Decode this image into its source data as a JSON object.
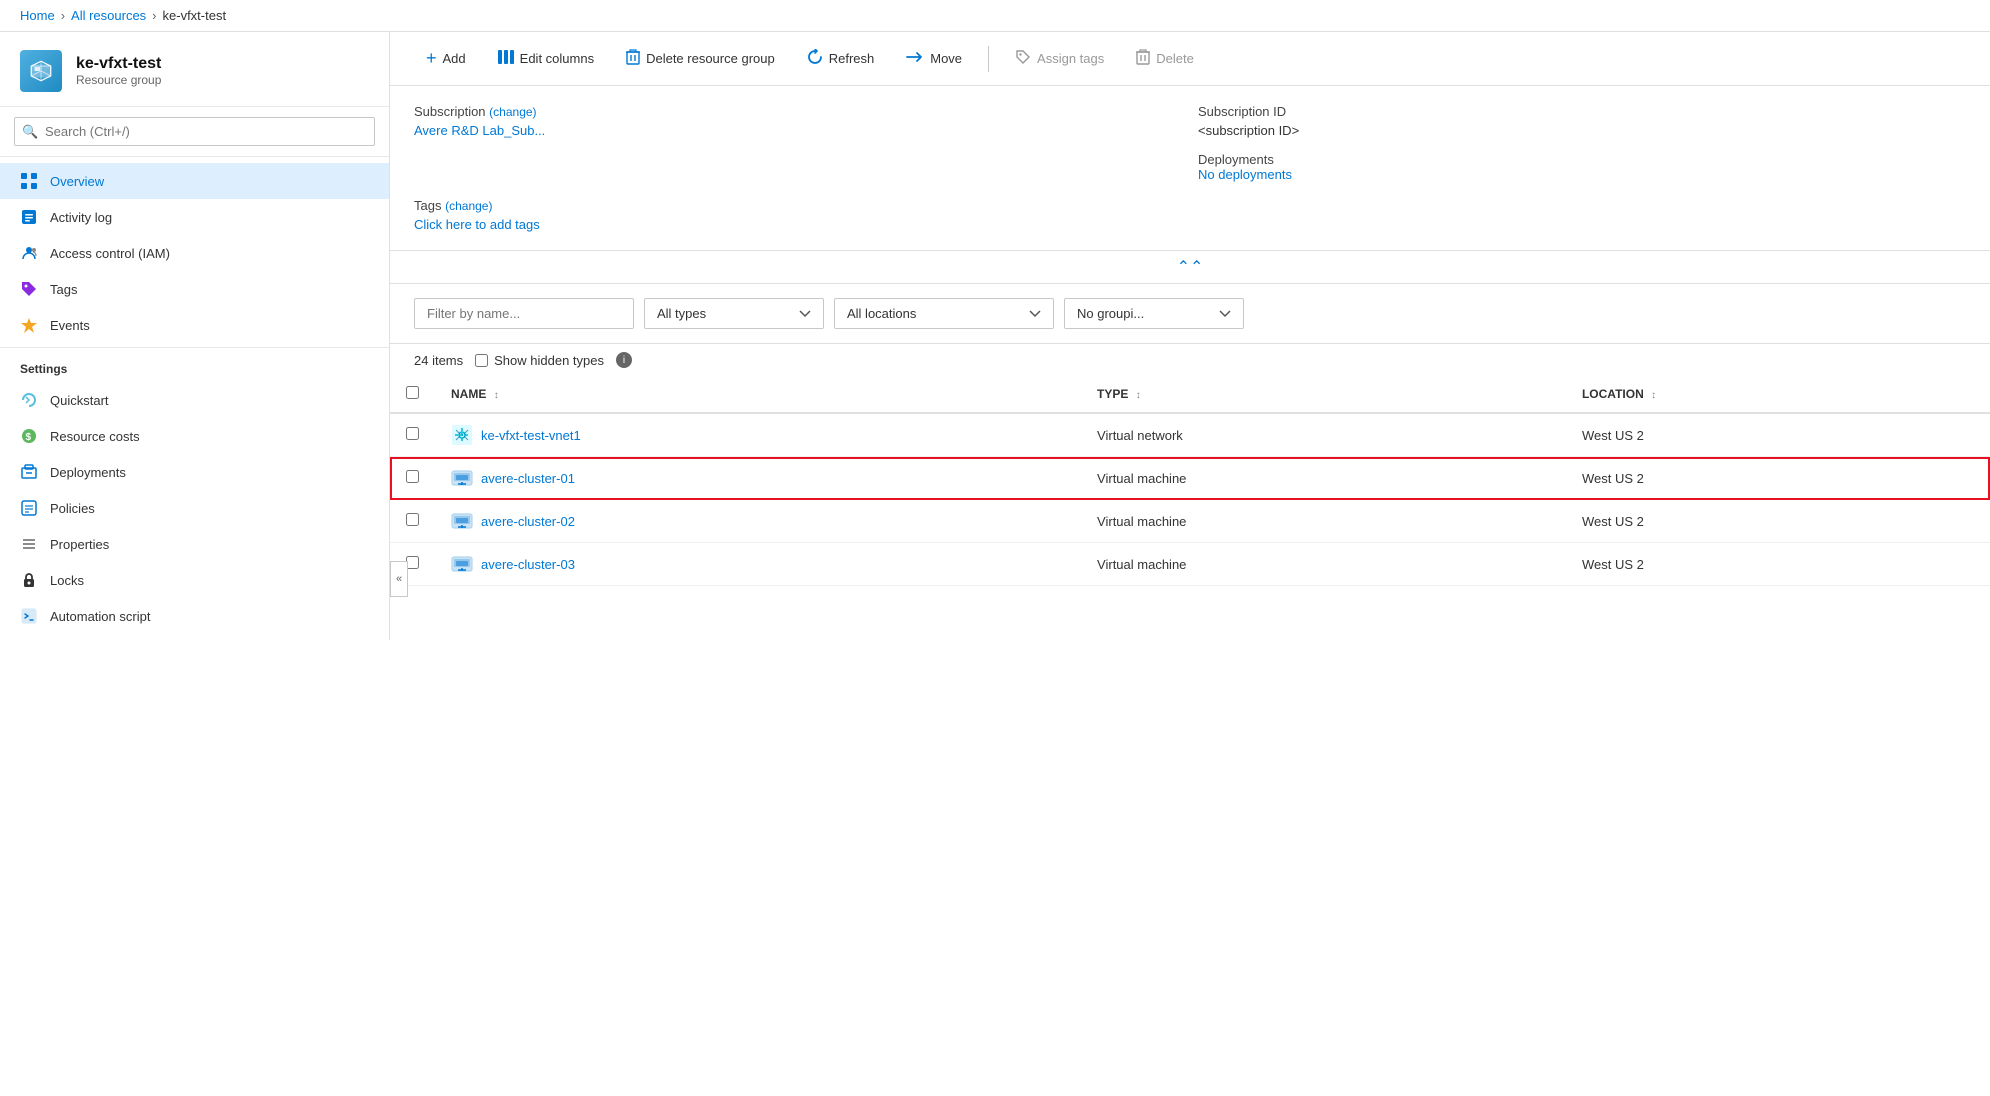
{
  "breadcrumb": {
    "home": "Home",
    "allResources": "All resources",
    "current": "ke-vfxt-test"
  },
  "sidebar": {
    "title": "ke-vfxt-test",
    "subtitle": "Resource group",
    "search": {
      "placeholder": "Search (Ctrl+/)"
    },
    "navItems": [
      {
        "id": "overview",
        "label": "Overview",
        "active": true
      },
      {
        "id": "activity-log",
        "label": "Activity log"
      },
      {
        "id": "access-control",
        "label": "Access control (IAM)"
      },
      {
        "id": "tags",
        "label": "Tags"
      },
      {
        "id": "events",
        "label": "Events"
      }
    ],
    "settingsTitle": "Settings",
    "settingsItems": [
      {
        "id": "quickstart",
        "label": "Quickstart"
      },
      {
        "id": "resource-costs",
        "label": "Resource costs"
      },
      {
        "id": "deployments",
        "label": "Deployments"
      },
      {
        "id": "policies",
        "label": "Policies"
      },
      {
        "id": "properties",
        "label": "Properties"
      },
      {
        "id": "locks",
        "label": "Locks"
      },
      {
        "id": "automation-script",
        "label": "Automation script"
      }
    ]
  },
  "toolbar": {
    "add": "Add",
    "editColumns": "Edit columns",
    "deleteResourceGroup": "Delete resource group",
    "refresh": "Refresh",
    "move": "Move",
    "assignTags": "Assign tags",
    "delete": "Delete"
  },
  "info": {
    "subscriptionLabel": "Subscription",
    "subscriptionChange": "(change)",
    "subscriptionValue": "Avere R&D Lab_Sub...",
    "subscriptionIdLabel": "Subscription ID",
    "subscriptionIdValue": "<subscription ID>",
    "deploymentsLabel": "Deployments",
    "deploymentsValue": "No deployments",
    "tagsLabel": "Tags",
    "tagsChange": "(change)",
    "tagsValue": "Click here to add tags"
  },
  "filters": {
    "filterPlaceholder": "Filter by name...",
    "allTypes": "All types",
    "allLocations": "All locations",
    "noGrouping": "No groupi..."
  },
  "itemsBar": {
    "count": "24 items",
    "showHiddenTypes": "Show hidden types"
  },
  "table": {
    "headers": {
      "name": "NAME",
      "type": "TYPE",
      "location": "LOCATION"
    },
    "rows": [
      {
        "id": "row-1",
        "name": "ke-vfxt-test-vnet1",
        "type": "Virtual network",
        "location": "West US 2",
        "resourceType": "vnet",
        "highlighted": false
      },
      {
        "id": "row-2",
        "name": "avere-cluster-01",
        "type": "Virtual machine",
        "location": "West US 2",
        "resourceType": "vm",
        "highlighted": true
      },
      {
        "id": "row-3",
        "name": "avere-cluster-02",
        "type": "Virtual machine",
        "location": "West US 2",
        "resourceType": "vm",
        "highlighted": false
      },
      {
        "id": "row-4",
        "name": "avere-cluster-03",
        "type": "Virtual machine",
        "location": "West US 2",
        "resourceType": "vm",
        "highlighted": false
      }
    ]
  }
}
